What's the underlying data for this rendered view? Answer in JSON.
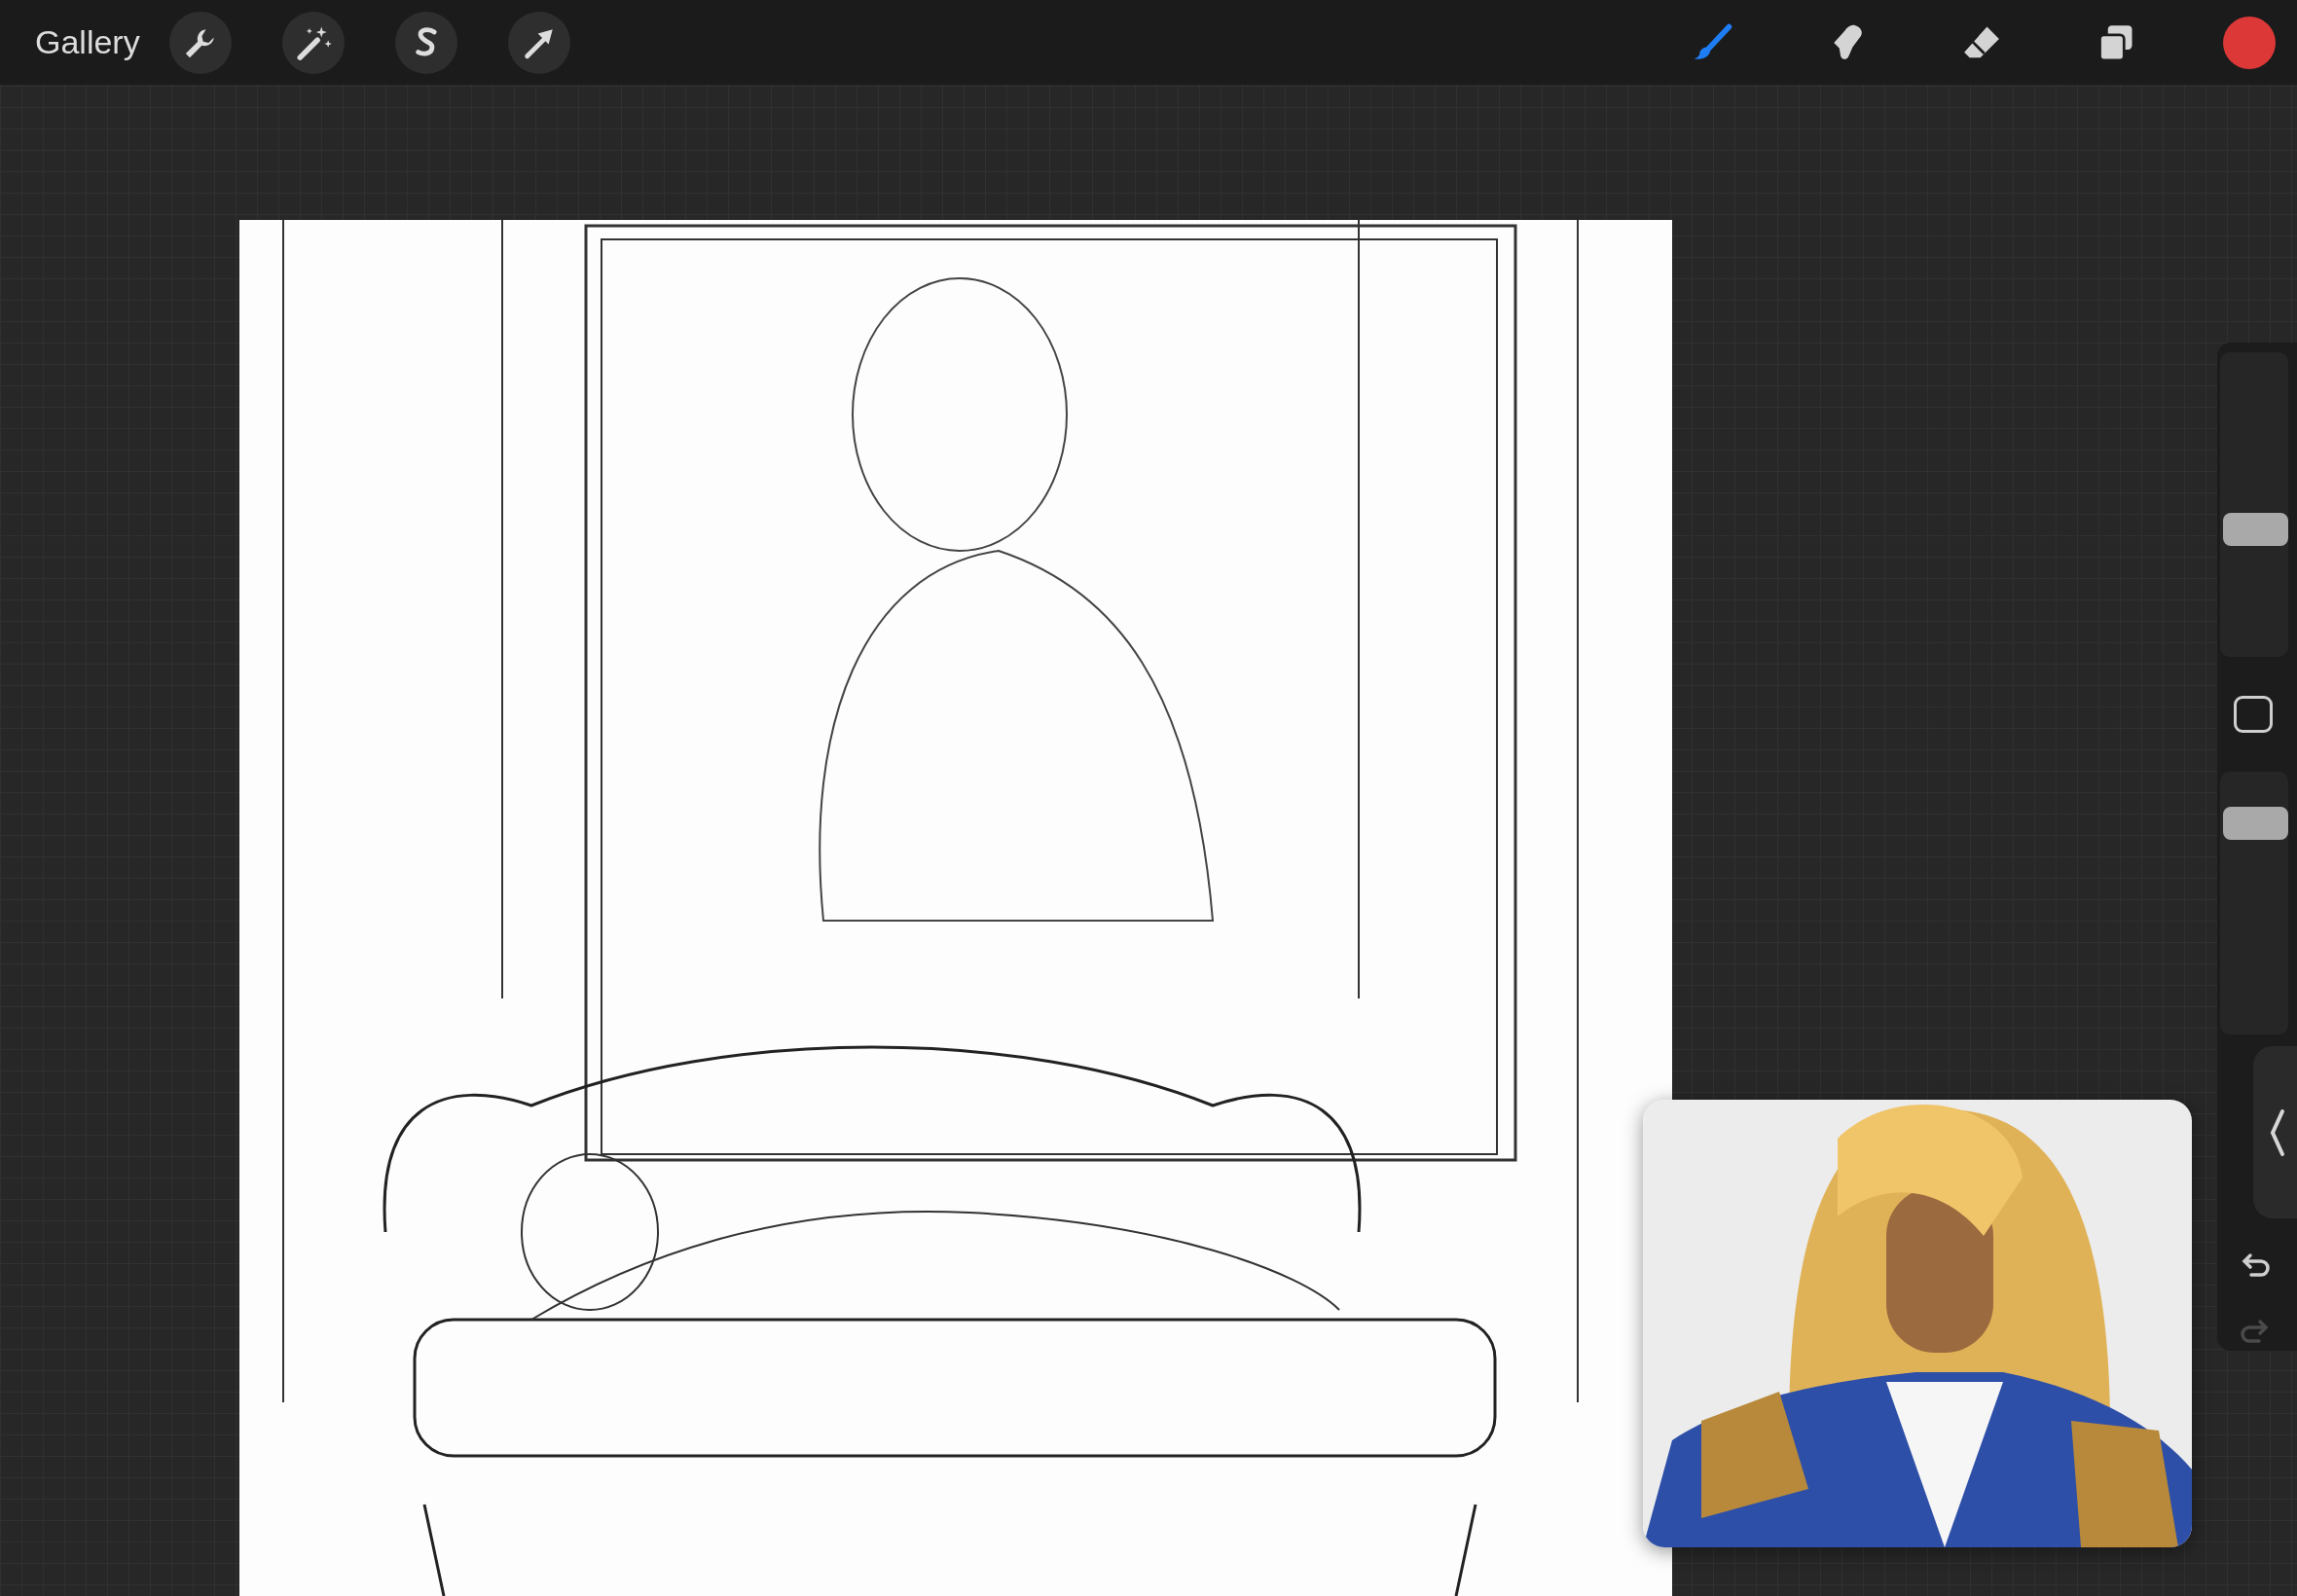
{
  "top_bar": {
    "gallery": "Gallery",
    "actions": [
      {
        "kind": "wrench"
      },
      {
        "kind": "wand"
      },
      {
        "kind": "selection"
      },
      {
        "kind": "transform"
      }
    ],
    "tools": [
      {
        "kind": "brush",
        "selected": true
      },
      {
        "kind": "smudge",
        "selected": false
      },
      {
        "kind": "eraser",
        "selected": false
      },
      {
        "kind": "layers",
        "selected": false
      }
    ]
  },
  "sidebar": {
    "size_slider": {
      "level": 0.42
    },
    "opacity_slider": {
      "level": 0.8
    }
  }
}
